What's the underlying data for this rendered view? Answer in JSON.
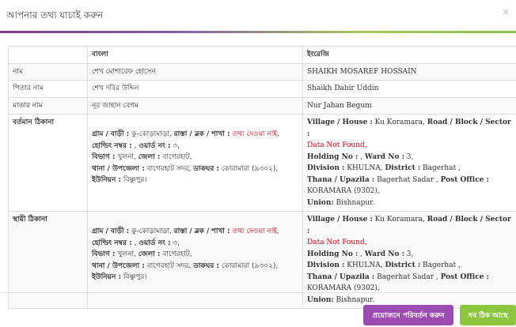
{
  "modal": {
    "title": "আপনার তথ্য যাচাই করুন",
    "close_glyph": "×"
  },
  "table": {
    "headers": [
      "",
      "বাংলা",
      "ইংরেজি"
    ],
    "rows": {
      "name": {
        "label": "নাম",
        "bn": "শেখ মোশারেফ হোসেন",
        "en": "SHAIKH MOSAREF HOSSAIN"
      },
      "father": {
        "label": "পিতার নাম",
        "bn": "শেখ দবির উদ্দিন",
        "en": "Shaikh Dabir Uddin"
      },
      "mother": {
        "label": "মাতার নাম",
        "bn": "নূর জাহান বেগম",
        "en": "Nur Jahan Begum"
      },
      "present": {
        "label": "বর্তমান ঠিকানা",
        "bn": {
          "village_label": "গ্রাম / বাড়ী :",
          "village_value": " কু-কোড়ামাড়া,",
          "road_label": "রাস্তা / ব্লক / শাখা :",
          "road_value": "তথ্য দেওয়া নাই,",
          "holding_label": "হোল্ডিং নম্বর :",
          "holding_value": " ,",
          "ward_label": "ওয়ার্ড নং :",
          "ward_value": " ৩,",
          "division_label": "বিভাগ :",
          "division_value": " খুলনা,",
          "district_label": "জেলা :",
          "district_value": " বাগেরহাট,",
          "thana_label": "থানা / উপজেলা :",
          "thana_value": " বাগেরহাট সদর,",
          "post_label": "ডাকঘর :",
          "post_value": " কোরামারা (৯৩০২),",
          "union_label": "ইউনিয়ন :",
          "union_value": " বিষ্ণুপুর।"
        },
        "en": {
          "village_label": "Village / House :",
          "village_value": " Ku Koramara,",
          "road_label": "Road / Block / Sector :",
          "road_value": "Data Not Found,",
          "holding_label": "Holding No :",
          "holding_value": " ,",
          "ward_label": "Ward No :",
          "ward_value": " 3,",
          "division_label": "Division :",
          "division_value": " KHULNA,",
          "district_label": "District :",
          "district_value": " Bagerhat ,",
          "thana_label": "Thana / Upazila :",
          "thana_value": " Bagerhat Sadar ,",
          "post_label": "Post Office :",
          "post_value": "KORAMARA (9302),",
          "union_label": "Union:",
          "union_value": " Bishnapur."
        }
      },
      "permanent": {
        "label": "স্থায়ী ঠিকানা",
        "bn": {
          "village_label": "গ্রাম / বাড়ী :",
          "village_value": " কু-কোড়ামাড়া,",
          "road_label": "রাস্তা / ব্লক / শাখা :",
          "road_value": "তথ্য দেওয়া নাই,",
          "holding_label": "হোল্ডিং নম্বর :",
          "holding_value": " ,",
          "ward_label": "ওয়ার্ড নং :",
          "ward_value": " ৩,",
          "division_label": "বিভাগ :",
          "division_value": " খুলনা,",
          "district_label": "জেলা :",
          "district_value": " বাগেরহাট,",
          "thana_label": "থানা / উপজেলা :",
          "thana_value": " বাগেরহাট সদর,",
          "post_label": "ডাকঘর :",
          "post_value": " কোরামারা (৯৩০২),",
          "union_label": "ইউনিয়ন :",
          "union_value": " বিষ্ণুপুর।"
        },
        "en": {
          "village_label": "Village / House :",
          "village_value": " Ku Koramara,",
          "road_label": "Road / Block / Sector :",
          "road_value": "Data Not Found,",
          "holding_label": "Holding No :",
          "holding_value": " ,",
          "ward_label": "Ward No :",
          "ward_value": " 3,",
          "division_label": "Division :",
          "division_value": " KHULNA,",
          "district_label": "District :",
          "district_value": " Bagerhat ,",
          "thana_label": "Thana / Upazila :",
          "thana_value": " Bagerhat Sadar ,",
          "post_label": "Post Office :",
          "post_value": "KORAMARA (9302),",
          "union_label": "Union:",
          "union_value": " Bishnapur."
        }
      }
    }
  },
  "footer": {
    "change_label": "প্রয়োজনে পরিবর্তন করুন",
    "ok_label": "সব ঠিক আছে"
  },
  "colors": {
    "accent_purple": "#9c4bb0",
    "accent_green": "#8cc63f",
    "not_found_red": "#d0021b"
  }
}
